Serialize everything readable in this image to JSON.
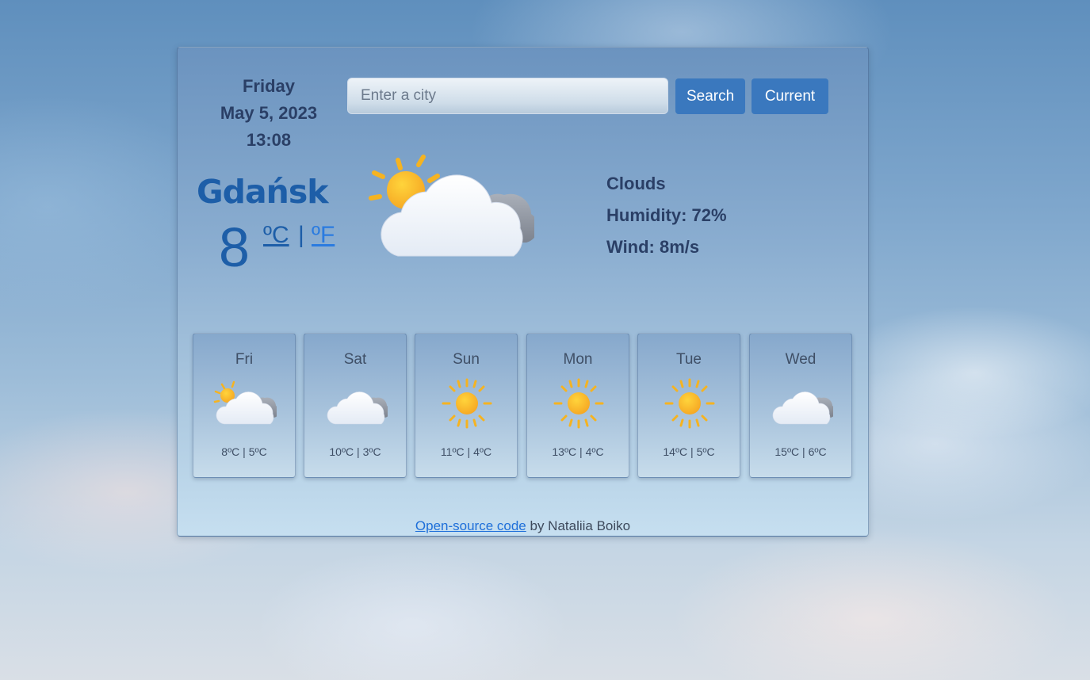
{
  "header": {
    "day": "Friday",
    "date": "May 5, 2023",
    "time": "13:08"
  },
  "search": {
    "placeholder": "Enter a city",
    "value": "",
    "search_label": "Search",
    "current_label": "Current"
  },
  "current": {
    "city": "Gdańsk",
    "temperature": "8",
    "unit_celsius": "ºC",
    "unit_separator": "|",
    "unit_fahrenheit": "ºF",
    "icon": "partly-cloudy-icon",
    "description": "Clouds",
    "humidity": "Humidity: 72%",
    "wind": "Wind: 8m/s"
  },
  "forecast": [
    {
      "day": "Fri",
      "icon": "partly-cloudy-icon",
      "temps": "8ºC | 5ºC"
    },
    {
      "day": "Sat",
      "icon": "cloud-icon",
      "temps": "10ºC | 3ºC"
    },
    {
      "day": "Sun",
      "icon": "sun-icon",
      "temps": "11ºC | 4ºC"
    },
    {
      "day": "Mon",
      "icon": "sun-icon",
      "temps": "13ºC | 4ºC"
    },
    {
      "day": "Tue",
      "icon": "sun-icon",
      "temps": "14ºC | 5ºC"
    },
    {
      "day": "Wed",
      "icon": "cloud-icon",
      "temps": "15ºC | 6ºC"
    }
  ],
  "footer": {
    "link_text": "Open-source code",
    "suffix": " by Nataliia Boiko"
  },
  "colors": {
    "accent": "#3a78be",
    "city": "#1d5ea8",
    "text_dark": "#2a3f66"
  }
}
